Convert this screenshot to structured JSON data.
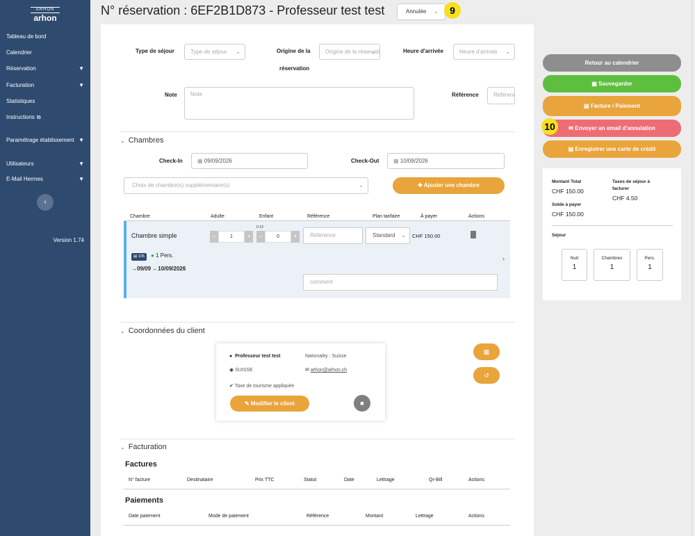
{
  "sidebar": {
    "logo_mark": "ARHON",
    "logo_word": "arhon",
    "items": [
      {
        "label": "Tableau de bord"
      },
      {
        "label": "Calendrier"
      },
      {
        "label": "Réservation"
      },
      {
        "label": "Facturation"
      },
      {
        "label": "Statistiques"
      },
      {
        "label": "Instructions"
      },
      {
        "label": "Paramétrage établissement"
      },
      {
        "label": "Utilisateurs"
      },
      {
        "label": "E-Mail Hermes"
      }
    ],
    "collapse_glyph": "‹",
    "version": "Version 1.74"
  },
  "header": {
    "title": "N° réservation : 6EF2B1D873 - Professeur test test",
    "status": "Annulée",
    "badge_status": "9"
  },
  "form": {
    "type_sejour_label": "Type de séjour",
    "type_sejour_placeholder": "Type de séjour",
    "origine_label_1": "Origine de la",
    "origine_label_2": "réservation",
    "origine_placeholder": "Origine de la réservation",
    "heure_label": "Heure d'arrivée",
    "heure_placeholder": "Heure d'arrivée",
    "note_label": "Note",
    "note_placeholder": "Note",
    "reference_label": "Référence",
    "reference_placeholder": "Référence"
  },
  "chambres": {
    "title": "Chambres",
    "checkin_label": "Check-In",
    "checkin_value": "09/09/2026",
    "checkout_label": "Check-Out",
    "checkout_value": "10/09/2026",
    "extra_rooms_placeholder": "Choix de chambre(s) supplémentaire(s)",
    "add_room_button": "Ajouter une chambre",
    "columns": [
      "Chambre",
      "Adulte",
      "Enfant",
      "Référence",
      "Plan tarifaire",
      "À payer",
      "Actions"
    ],
    "row": {
      "name": "Chambre simple",
      "adults": "1",
      "children_hint": "0-12",
      "children": "0",
      "reference_placeholder": "Référence",
      "plan": "Standard",
      "price": "CHF 150.00",
      "room_number": "105",
      "persons": "1 Pers.",
      "dates": "09/09",
      "dates_end": "10/09/2026",
      "comment_placeholder": "comment"
    }
  },
  "client": {
    "title": "Coordonnées du client",
    "name": "Professeur  test test",
    "nationality": "Nationality : Suisse",
    "country": "SUISSE",
    "email": "arhon@arhon.ch",
    "tax_note": "Taxe de tourisme appliquée",
    "edit_button": "Modifier le client"
  },
  "facturation": {
    "title": "Facturation",
    "factures_title": "Factures",
    "factures_columns": [
      "N° facture",
      "Destinataire",
      "Prix TTC",
      "Statut",
      "Date",
      "Lettrage",
      "Qr-Bill",
      "Actions"
    ],
    "paiements_title": "Paiements",
    "paiements_columns": [
      "Date paiement",
      "Mode de paiement",
      "Référence",
      "Montant",
      "Lettrage",
      "Actions"
    ]
  },
  "actions": {
    "back": "Retour au calendrier",
    "save": "Sauvegarder",
    "invoice": "Facture / Paiement",
    "cancel_email": "Envoyer un email d'annulation",
    "card": "Enregistrer une carte de crédit",
    "badge_email": "10"
  },
  "summary": {
    "total_label": "Montant Total",
    "total_value": "CHF 150.00",
    "tax_label_1": "Taxes de séjour à",
    "tax_label_2": "facturer",
    "tax_value": "CHF 4.50",
    "balance_label": "Solde à payer",
    "balance_value": "CHF 150.00",
    "sejour_label": "Séjour",
    "nights_label": "Nuit",
    "nights_value": "1",
    "rooms_label": "Chambres",
    "rooms_value": "1",
    "persons_label": "Pers.",
    "persons_value": "1"
  },
  "colors": {
    "sidebar": "#2e4a6e",
    "accent_orange": "#e9a43b",
    "save_green": "#5ebf3f",
    "back_grey": "#8e8e8e",
    "cancel_red": "#ee6d75",
    "badge_yellow": "#f7e01e"
  }
}
